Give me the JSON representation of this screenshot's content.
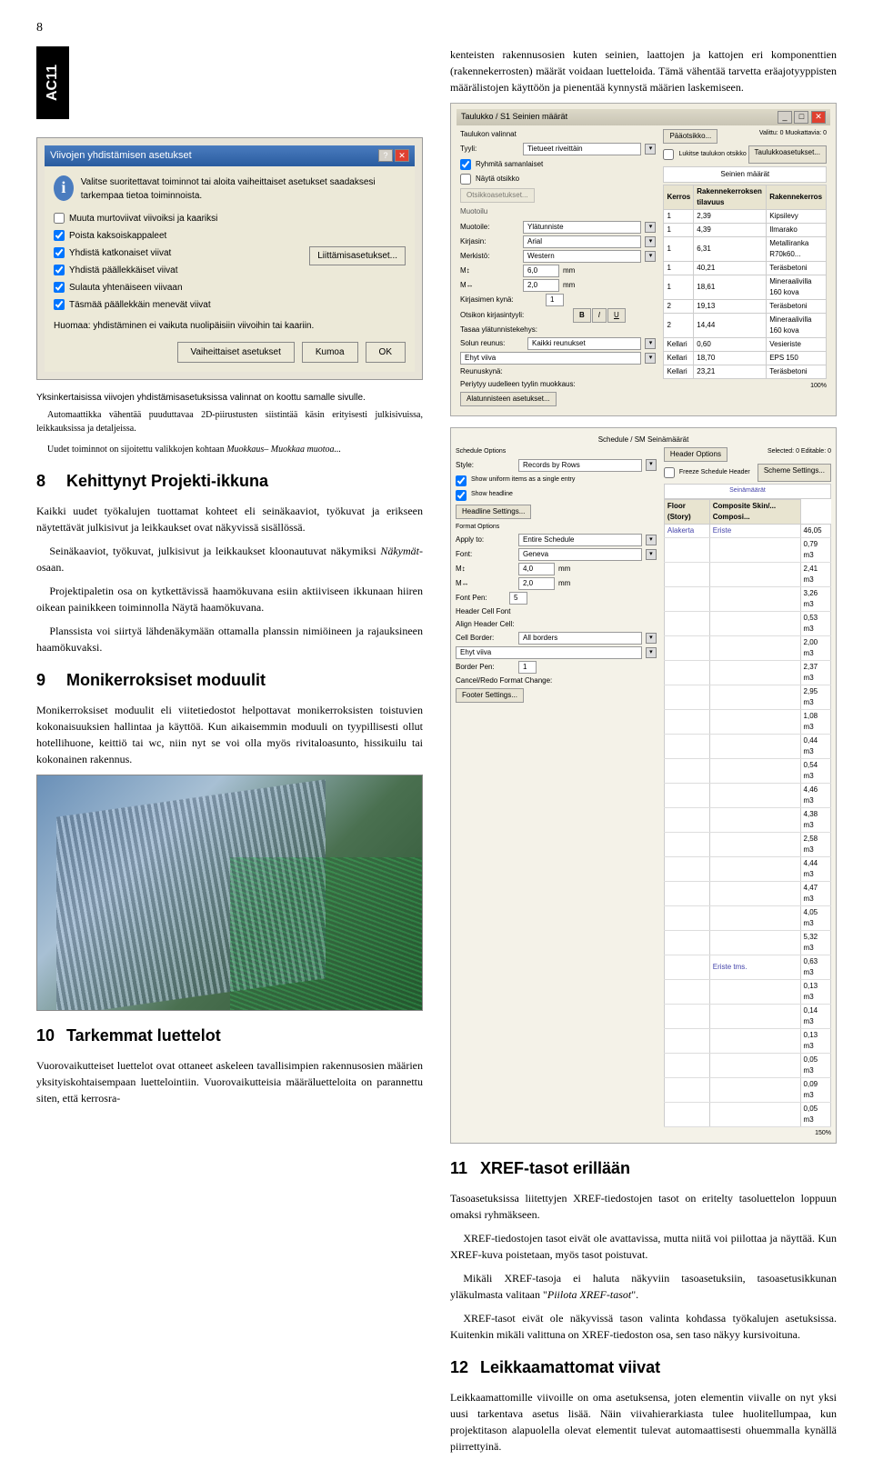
{
  "page_number_top": "8",
  "tab": "AC11",
  "top_para1": "kenteisten rakennusosien kuten seinien, laattojen ja kattojen eri komponenttien (rakennekerrosten) määrät voidaan luetteloida. Tämä vähentää tarvetta eräajotyyppisten määrälistojen käyttöön ja pienentää kynnystä määrien laskemiseen.",
  "dialog1": {
    "title": "Viivojen yhdistämisen asetukset",
    "instr": "Valitse suoritettavat toiminnot tai aloita vaiheittaiset asetukset saadaksesi tarkempaa tietoa toiminnoista.",
    "checks": [
      {
        "label": "Muuta murtoviivat viivoiksi ja kaariksi",
        "checked": false
      },
      {
        "label": "Poista kaksoiskappaleet",
        "checked": true
      },
      {
        "label": "Yhdistä katkonaiset viivat",
        "checked": true
      },
      {
        "label": "Yhdistä päällekkäiset viivat",
        "checked": true
      },
      {
        "label": "Sulauta yhtenäiseen viivaan",
        "checked": true
      },
      {
        "label": "Täsmää päällekkäin menevät viivat",
        "checked": true
      }
    ],
    "link_btn": "Liittämisasetukset...",
    "note": "Huomaa: yhdistäminen ei vaikuta nuolipäisiin viivoihin tai kaariin.",
    "btn1": "Vaiheittaiset asetukset",
    "btn2": "Kumoa",
    "btn3": "OK"
  },
  "caption1a": "Yksinkertaisissa viivojen yhdistämisasetuksissa valinnat on koottu samalle sivulle.",
  "caption1b": "Automaattikka vähentää puuduttavaa 2D-piirustusten siistintää käsin erityisesti julkisivuissa, leikkauksissa ja detaljeissa.",
  "caption1c": "Uudet toiminnot on sijoitettu valikkojen kohtaan Muokkaus– Muokkaa muotoa...",
  "sec8": {
    "num": "8",
    "title": "Kehittynyt Projekti-ikkuna"
  },
  "p8a": "Kaikki uudet työkalujen tuottamat kohteet eli seinäkaaviot, työkuvat ja erikseen näytettävät julkisivut ja leikkaukset ovat näkyvissä sisällössä.",
  "p8b": "Seinäkaaviot, työkuvat, julkisivut ja leikkaukset kloonautuvat näkymiksi Näkymät-osaan.",
  "p8c": "Projektipaletin osa on kytkettävissä haamökuvana esiin aktiiviseen ikkunaan hiiren oikean painikkeen toiminnolla Näytä haamökuvana.",
  "p8d": "Planssista voi siirtyä lähdenäkymään ottamalla planssin nimiöineen ja rajauksineen haamökuvaksi.",
  "sec9": {
    "num": "9",
    "title": "Monikerroksiset moduulit"
  },
  "p9a": "Monikerroksiset moduulit eli viitetiedostot helpottavat monikerroksisten toistuvien kokonaisuuksien hallintaa ja käyttöä. Kun aikaisemmin moduuli on tyypillisesti ollut hotellihuone, keittiö tai wc, niin nyt se voi olla myös rivitaloasunto, hissikuilu tai kokonainen rakennus.",
  "sec10": {
    "num": "10",
    "title": "Tarkemmat luettelot"
  },
  "p10a": "Vuorovaikutteiset luettelot ovat ottaneet askeleen tavallisimpien rakennusosien määrien yksityiskohtaisempaan luettelointiin. Vuorovaikutteisia määräluetteloita on parannettu siten, että kerrosra-",
  "sec11": {
    "num": "11",
    "title": "XREF-tasot erillään"
  },
  "p11a": "Tasoasetuksissa liitettyjen XREF-tiedostojen tasot on eritelty tasoluettelon loppuun omaksi ryhmäkseen.",
  "p11b": "XREF-tiedostojen tasot eivät ole avattavissa, mutta niitä voi piilottaa ja näyttää. Kun XREF-kuva poistetaan, myös tasot poistuvat.",
  "p11c": "Mikäli XREF-tasoja ei haluta näkyviin tasoasetuksiin, tasoasetusikkunan yläkulmasta valitaan \"Piilota XREF-tasot\".",
  "p11d": "XREF-tasot eivät ole näkyvissä tason valinta kohdassa työkalujen asetuksissa. Kuitenkin mikäli valittuna on XREF-tiedoston osa, sen taso näkyy kursivoituna.",
  "sec12": {
    "num": "12",
    "title": "Leikkaamattomat viivat"
  },
  "p12a": "Leikkaamattomille viivoille on oma asetuksensa, joten elementin viivalle on nyt yksi uusi tarkentava asetus lisää. Näin viivahierarkiasta tulee huolitellumpaa, kun projektitason alapuolella olevat elementit tulevat automaattisesti ohuemmalla kynällä piirrettyinä.",
  "luettelo": {
    "title": "Taulukko / S1 Seinien määrät",
    "header_ops": "Pääotsikko...",
    "valittu": "Valittu:  0    Muokattavia: 0",
    "header_ops2": "Taulukkoasetukset...",
    "type_label": "Tyyli:",
    "type_value": "Tietueet riveittäin",
    "lock_label": "Lukitse taulukon otsikko",
    "ryhm": "Ryhmitä samanlaiset",
    "nayta": "Näytä otsikko",
    "ots_btn": "Otsikkoasetukset...",
    "seinien": "Seinien määrät",
    "muotoilu": "Muotoilu",
    "muotoile_l": "Muotoile:",
    "muotoile_v": "Ylätunniste",
    "kirjasin_l": "Kirjasin:",
    "kirjasin_v": "Arial",
    "merkisto_l": "Merkistö:",
    "merkisto_v": "Western",
    "m1_l": "M↕",
    "m1_v": "6,0",
    "m1_u": "mm",
    "m2_l": "M↔",
    "m2_v": "2,0",
    "m2_u": "mm",
    "kirj_kyna": "Kirjasimen kynä:",
    "ots_kirj": "Otsikon kirjasintyyli:",
    "tasaa": "Tasaa ylätunnistekehys:",
    "solun": "Solun reunus:",
    "solun_v": "Kaikki reunukset",
    "ehyt": "Ehyt viiva",
    "reunus": "Reunuskynä:",
    "perytyy": "Periytyy uudelleen tyylin muokkaus:",
    "ala_btn": "Alatunnisteen asetukset...",
    "zoom": "100%",
    "cols": [
      "Kerros",
      "Rakennekerroksen tilavuus",
      "Rakennekerros"
    ],
    "rows": [
      [
        "1",
        "2,39",
        "Kipsilevy"
      ],
      [
        "1",
        "4,39",
        "Ilmarako"
      ],
      [
        "1",
        "6,31",
        "Metalliranka R70k60..."
      ],
      [
        "1",
        "40,21",
        "Teräsbetoni"
      ],
      [
        "1",
        "18,61",
        "Mineraalivilla 160 kova"
      ],
      [
        "2",
        "19,13",
        "Teräsbetoni"
      ],
      [
        "2",
        "14,44",
        "Mineraalivilla 160 kova"
      ],
      [
        "Kellari",
        "0,60",
        "Vesieriste"
      ],
      [
        "Kellari",
        "18,70",
        "EPS 150"
      ],
      [
        "Kellari",
        "23,21",
        "Teräsbetoni"
      ]
    ]
  },
  "schedule": {
    "title": "Schedule / SM Seinämäärät",
    "header_ops": "Header Options",
    "sel": "Selected:  0   Editable:  0",
    "schema_btn": "Scheme Settings...",
    "sched_opts": "Schedule Options",
    "style_l": "Style:",
    "style_v": "Records by Rows",
    "show_uniform": "Show uniform items as a single entry",
    "freeze": "Freeze Schedule Header",
    "show_head": "Show headline",
    "headline_btn": "Headline Settings...",
    "format_opts": "Format Options",
    "apply_l": "Apply to:",
    "apply_v": "Entire Schedule",
    "font_l": "Font:",
    "font_v": "Geneva",
    "m1_l": "M↕",
    "m1_v": "4,0",
    "m1_u": "mm",
    "m2_l": "M↔",
    "m2_v": "2,0",
    "m2_u": "mm",
    "font_pen": "Font Pen:",
    "hdr_font": "Header Cell Font",
    "align_hdr": "Align Header Cell:",
    "cell_border_l": "Cell Border:",
    "cell_border_v": "All borders",
    "ehyt": "Ehyt viiva",
    "border_pen": "Border Pen:",
    "cancel_redo": "Cancel/Redo Format Change:",
    "footer_btn": "Footer Settings...",
    "zoom": "150%",
    "h_seina": "Seinämäärät",
    "h_floor": "Floor (Story)",
    "h_comp": "Composite Skin/... Composi...",
    "alakerta": "Alakerta",
    "eriste": "Eriste",
    "eriste_tms": "Eriste tms.",
    "vals": [
      "46,05",
      "0,79 m3",
      "2,41 m3",
      "3,26 m3",
      "0,53 m3",
      "2,00 m3",
      "2,37 m3",
      "2,95 m3",
      "1,08 m3",
      "0,44 m3",
      "0,54 m3",
      "4,46 m3",
      "4,38 m3",
      "2,58 m3",
      "4,44 m3",
      "4,47 m3",
      "4,05 m3",
      "5,32 m3",
      "0,63 m3",
      "0,13 m3",
      "0,14 m3",
      "0,13 m3",
      "0,05 m3",
      "0,09 m3",
      "0,05 m3"
    ]
  }
}
